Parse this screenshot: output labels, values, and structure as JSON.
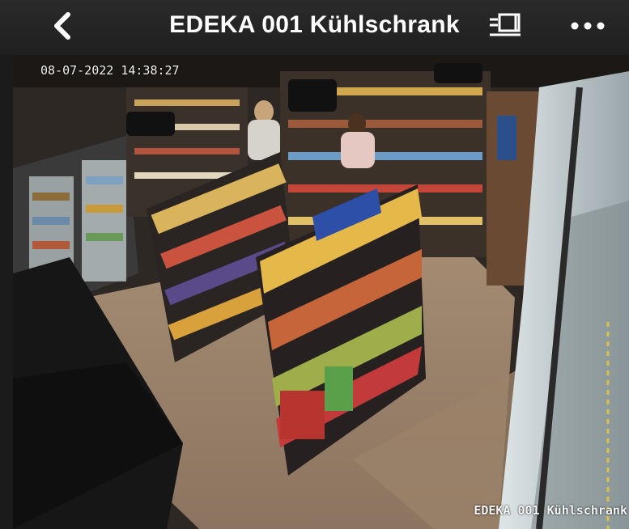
{
  "header": {
    "title": "EDEKA 001 Kühlschrank",
    "back_icon": "chevron-left-icon",
    "screen_icon": "screen-fullscreen-icon",
    "more_icon": "more-dots-icon"
  },
  "video": {
    "timestamp": "08-07-2022 14:38:27",
    "camera_label": "EDEKA 001 Kühlschrank"
  },
  "colors": {
    "header_bg": "#222222",
    "header_text": "#ffffff"
  }
}
